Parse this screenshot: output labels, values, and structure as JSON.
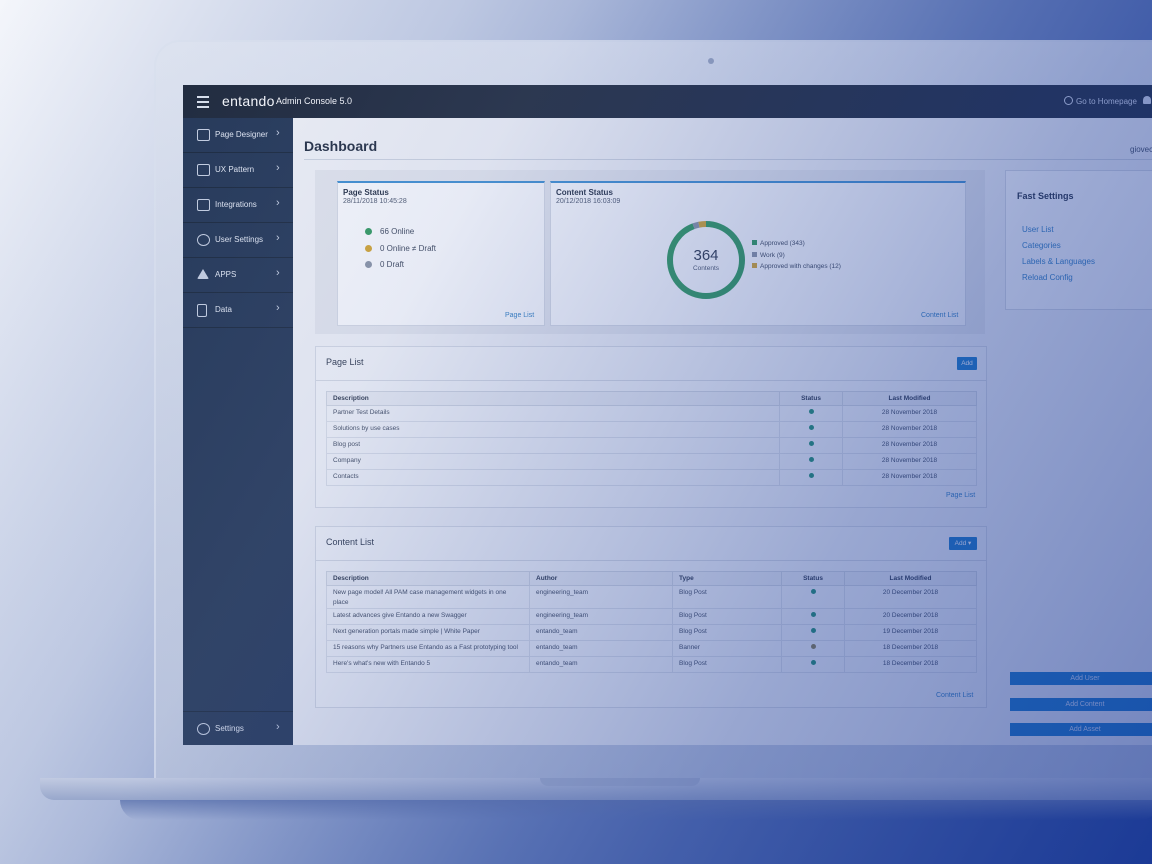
{
  "topbar": {
    "brand": "entando",
    "console": "Admin Console 5.0",
    "go_home": "Go to Homepage"
  },
  "sidebar": {
    "items": [
      {
        "label": "Page Designer"
      },
      {
        "label": "UX Pattern"
      },
      {
        "label": "Integrations"
      },
      {
        "label": "User Settings"
      },
      {
        "label": "APPS"
      },
      {
        "label": "Data"
      }
    ],
    "settings": "Settings"
  },
  "dashboard": {
    "title": "Dashboard",
    "user": "giovec"
  },
  "page_status": {
    "title": "Page Status",
    "date": "28/11/2018 10:45:28",
    "rows": [
      {
        "label": "66 Online",
        "color": "#2e9a5a"
      },
      {
        "label": "0 Online ≠ Draft",
        "color": "#d6a52a"
      },
      {
        "label": "0 Draft",
        "color": "#8a93a3"
      }
    ],
    "link": "Page List"
  },
  "content_status": {
    "title": "Content Status",
    "date": "20/12/2018 16:03:09",
    "total": "364",
    "total_label": "Contents",
    "legend": [
      {
        "label": "Approved (343)",
        "value": 343,
        "color": "#2e9a5a"
      },
      {
        "label": "Work (9)",
        "value": 9,
        "color": "#8a93a3"
      },
      {
        "label": "Approved with changes (12)",
        "value": 12,
        "color": "#d6a52a"
      }
    ],
    "link": "Content List"
  },
  "page_list": {
    "title": "Page List",
    "add": "Add",
    "headers": [
      "Description",
      "Status",
      "Last Modified"
    ],
    "rows": [
      {
        "desc": "Partner Test Details",
        "date": "28 November 2018"
      },
      {
        "desc": "Solutions by use cases",
        "date": "28 November 2018"
      },
      {
        "desc": "Blog post",
        "date": "28 November 2018"
      },
      {
        "desc": "Company",
        "date": "28 November 2018"
      },
      {
        "desc": "Contacts",
        "date": "28 November 2018"
      }
    ],
    "link": "Page List"
  },
  "content_list": {
    "title": "Content List",
    "add": "Add ▾",
    "headers": [
      "Description",
      "Author",
      "Type",
      "Status",
      "Last Modified"
    ],
    "rows": [
      {
        "desc": "New page model! All PAM case management widgets in one place",
        "author": "engineering_team",
        "type": "Blog Post",
        "date": "20 December 2018"
      },
      {
        "desc": "Latest advances give Entando a new Swagger",
        "author": "engineering_team",
        "type": "Blog Post",
        "date": "20 December 2018"
      },
      {
        "desc": "Next generation portals made simple | White Paper",
        "author": "entando_team",
        "type": "Blog Post",
        "date": "19 December 2018"
      },
      {
        "desc": "15 reasons why Partners use Entando as a Fast prototyping tool",
        "author": "entando_team",
        "type": "Banner",
        "date": "18 December 2018"
      },
      {
        "desc": "Here's what's new with Entando 5",
        "author": "entando_team",
        "type": "Blog Post",
        "date": "18 December 2018"
      }
    ],
    "link": "Content List"
  },
  "fast_settings": {
    "title": "Fast Settings",
    "links": [
      "User List",
      "Categories",
      "Labels & Languages",
      "Reload Config"
    ],
    "buttons": [
      "Add User",
      "Add Content",
      "Add Asset"
    ]
  }
}
